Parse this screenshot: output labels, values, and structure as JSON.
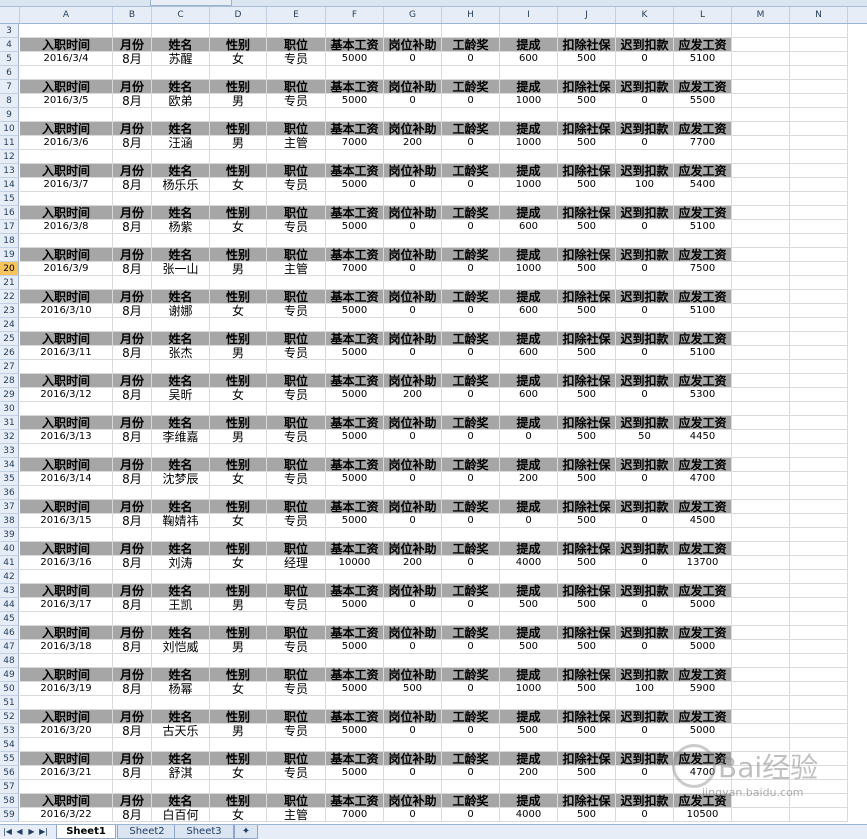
{
  "columns": [
    "A",
    "B",
    "C",
    "D",
    "E",
    "F",
    "G",
    "H",
    "I",
    "J",
    "K",
    "L",
    "M",
    "N"
  ],
  "header_labels": [
    "入职时间",
    "月份",
    "姓名",
    "性别",
    "职位",
    "基本工资",
    "岗位补助",
    "工龄奖",
    "提成",
    "扣除社保",
    "迟到扣款",
    "应发工资"
  ],
  "row_numbers": [
    "3",
    "4",
    "5",
    "6",
    "7",
    "8",
    "9",
    "10",
    "11",
    "12",
    "13",
    "14",
    "15",
    "16",
    "17",
    "18",
    "19",
    "20",
    "21",
    "22",
    "23",
    "24",
    "25",
    "26",
    "27",
    "28",
    "29",
    "30",
    "31",
    "32",
    "33",
    "34",
    "35",
    "36",
    "37",
    "38",
    "39",
    "40",
    "41",
    "42",
    "43",
    "44",
    "45",
    "46",
    "47",
    "48",
    "49",
    "50",
    "51",
    "52",
    "53",
    "54",
    "55",
    "56",
    "57",
    "58",
    "59"
  ],
  "active_row": "20",
  "records": [
    [
      "2016/3/4",
      "8月",
      "苏醒",
      "女",
      "专员",
      "5000",
      "0",
      "0",
      "600",
      "500",
      "0",
      "5100"
    ],
    [
      "2016/3/5",
      "8月",
      "欧弟",
      "男",
      "专员",
      "5000",
      "0",
      "0",
      "1000",
      "500",
      "0",
      "5500"
    ],
    [
      "2016/3/6",
      "8月",
      "汪涵",
      "男",
      "主管",
      "7000",
      "200",
      "0",
      "1000",
      "500",
      "0",
      "7700"
    ],
    [
      "2016/3/7",
      "8月",
      "杨乐乐",
      "女",
      "专员",
      "5000",
      "0",
      "0",
      "1000",
      "500",
      "100",
      "5400"
    ],
    [
      "2016/3/8",
      "8月",
      "杨紫",
      "女",
      "专员",
      "5000",
      "0",
      "0",
      "600",
      "500",
      "0",
      "5100"
    ],
    [
      "2016/3/9",
      "8月",
      "张一山",
      "男",
      "主管",
      "7000",
      "0",
      "0",
      "1000",
      "500",
      "0",
      "7500"
    ],
    [
      "2016/3/10",
      "8月",
      "谢娜",
      "女",
      "专员",
      "5000",
      "0",
      "0",
      "600",
      "500",
      "0",
      "5100"
    ],
    [
      "2016/3/11",
      "8月",
      "张杰",
      "男",
      "专员",
      "5000",
      "0",
      "0",
      "600",
      "500",
      "0",
      "5100"
    ],
    [
      "2016/3/12",
      "8月",
      "吴昕",
      "女",
      "专员",
      "5000",
      "200",
      "0",
      "600",
      "500",
      "0",
      "5300"
    ],
    [
      "2016/3/13",
      "8月",
      "李维嘉",
      "男",
      "专员",
      "5000",
      "0",
      "0",
      "0",
      "500",
      "50",
      "4450"
    ],
    [
      "2016/3/14",
      "8月",
      "沈梦辰",
      "女",
      "专员",
      "5000",
      "0",
      "0",
      "200",
      "500",
      "0",
      "4700"
    ],
    [
      "2016/3/15",
      "8月",
      "鞠婧祎",
      "女",
      "专员",
      "5000",
      "0",
      "0",
      "0",
      "500",
      "0",
      "4500"
    ],
    [
      "2016/3/16",
      "8月",
      "刘涛",
      "女",
      "经理",
      "10000",
      "200",
      "0",
      "4000",
      "500",
      "0",
      "13700"
    ],
    [
      "2016/3/17",
      "8月",
      "王凯",
      "男",
      "专员",
      "5000",
      "0",
      "0",
      "500",
      "500",
      "0",
      "5000"
    ],
    [
      "2016/3/18",
      "8月",
      "刘恺威",
      "男",
      "专员",
      "5000",
      "0",
      "0",
      "500",
      "500",
      "0",
      "5000"
    ],
    [
      "2016/3/19",
      "8月",
      "杨幂",
      "女",
      "专员",
      "5000",
      "500",
      "0",
      "1000",
      "500",
      "100",
      "5900"
    ],
    [
      "2016/3/20",
      "8月",
      "古天乐",
      "男",
      "专员",
      "5000",
      "0",
      "0",
      "500",
      "500",
      "0",
      "5000"
    ],
    [
      "2016/3/21",
      "8月",
      "舒淇",
      "女",
      "专员",
      "5000",
      "0",
      "0",
      "200",
      "500",
      "0",
      "4700"
    ],
    [
      "2016/3/22",
      "8月",
      "白百何",
      "女",
      "主管",
      "7000",
      "0",
      "0",
      "4000",
      "500",
      "0",
      "10500"
    ]
  ],
  "sheet_tabs": [
    {
      "label": "Sheet1",
      "active": true
    },
    {
      "label": "Sheet2",
      "active": false
    },
    {
      "label": "Sheet3",
      "active": false
    }
  ],
  "nav_buttons": [
    "|◀",
    "◀",
    "▶",
    "▶|"
  ],
  "watermark": {
    "text": "Bai经验",
    "sub": "jingyan.baidu.com"
  }
}
